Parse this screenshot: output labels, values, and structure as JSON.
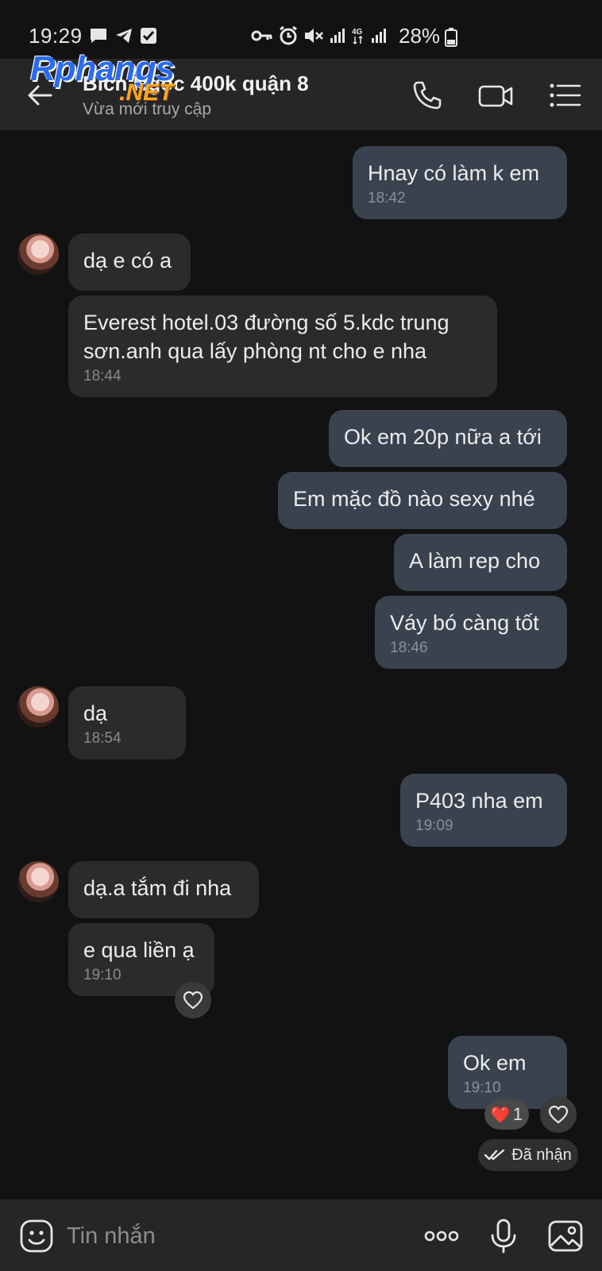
{
  "status_bar": {
    "time": "19:29",
    "battery": "28%",
    "network": "4G",
    "left_icons": [
      "message-icon",
      "telegram-icon",
      "checkbox-icon"
    ],
    "right_icons": [
      "key-icon",
      "alarm-icon",
      "mute-icon",
      "signal-icon",
      "4g-icon",
      "signal-icon",
      "battery-icon"
    ]
  },
  "watermark": {
    "main": "Rphangs",
    "sub": ".NET"
  },
  "header": {
    "title": "Bích Ngọc 400k quận 8",
    "subtitle": "Vừa mới truy cập"
  },
  "messages": [
    {
      "side": "out",
      "text": "Hnay có làm k em",
      "time": "18:42"
    },
    {
      "side": "in",
      "text": "dạ e có a",
      "time": ""
    },
    {
      "side": "in",
      "text": "Everest hotel.03 đường số 5.kdc trung",
      "text2": "sơn.anh qua lấy phòng nt cho e nha",
      "time": "18:44"
    },
    {
      "side": "out",
      "text": "Ok em 20p nữa a tới",
      "time": ""
    },
    {
      "side": "out",
      "text": "Em mặc đồ nào sexy nhé",
      "time": ""
    },
    {
      "side": "out",
      "text": "A làm rep cho",
      "time": ""
    },
    {
      "side": "out",
      "text": "Váy bó càng tốt",
      "time": "18:46"
    },
    {
      "side": "in",
      "text": "dạ",
      "time": "18:54"
    },
    {
      "side": "out",
      "text": "P403 nha em",
      "time": "19:09"
    },
    {
      "side": "in",
      "text": "dạ.a tắm đi nha",
      "time": ""
    },
    {
      "side": "in",
      "text": "e qua liền ạ",
      "time": "19:10"
    },
    {
      "side": "out",
      "text": "Ok em",
      "time": "19:10"
    }
  ],
  "reaction": {
    "emoji": "❤️",
    "count": "1"
  },
  "delivery_status": "Đã nhận",
  "input": {
    "placeholder": "Tin nhắn"
  },
  "colors": {
    "background": "#121212",
    "header": "#262626",
    "outgoing_bubble": "#3a4250",
    "incoming_bubble": "#2b2b2b"
  }
}
